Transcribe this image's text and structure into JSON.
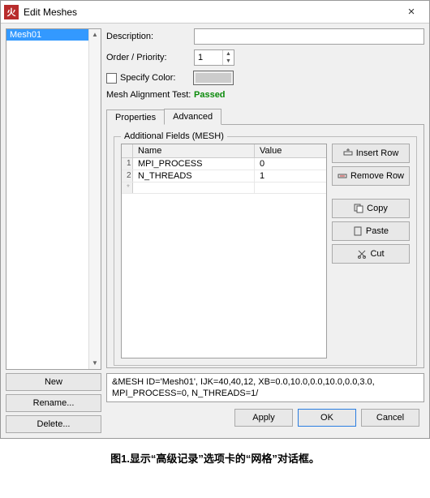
{
  "window": {
    "title": "Edit Meshes"
  },
  "list": {
    "items": [
      "Mesh01"
    ],
    "selected": 0
  },
  "left_buttons": {
    "new": "New",
    "rename": "Rename...",
    "delete": "Delete..."
  },
  "form": {
    "description_label": "Description:",
    "description_value": "",
    "order_label": "Order / Priority:",
    "order_value": "1",
    "specify_color_label": "Specify Color:",
    "mesh_align_label": "Mesh Alignment Test:",
    "mesh_align_status": "Passed"
  },
  "tabs": {
    "properties": "Properties",
    "advanced": "Advanced",
    "active": "advanced"
  },
  "group": {
    "label": "Additional Fields (MESH)"
  },
  "table": {
    "headers": {
      "name": "Name",
      "value": "Value"
    },
    "rows": [
      {
        "idx": "1",
        "name": "MPI_PROCESS",
        "value": "0"
      },
      {
        "idx": "2",
        "name": "N_THREADS",
        "value": "1"
      }
    ],
    "ghost_idx": "*"
  },
  "side_buttons": {
    "insert": "Insert Row",
    "remove": "Remove Row",
    "copy": "Copy",
    "paste": "Paste",
    "cut": "Cut"
  },
  "preview": "&MESH ID='Mesh01', IJK=40,40,12, XB=0.0,10.0,0.0,10.0,0.0,3.0, MPI_PROCESS=0, N_THREADS=1/",
  "footer": {
    "apply": "Apply",
    "ok": "OK",
    "cancel": "Cancel"
  },
  "caption": "图1.显示“高级记录”选项卡的“网格”对话框。"
}
